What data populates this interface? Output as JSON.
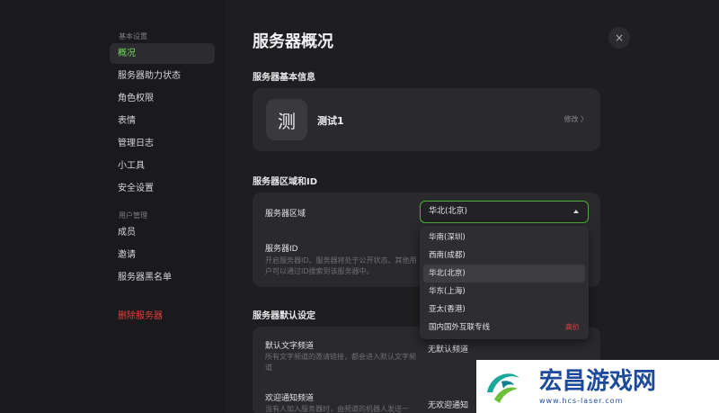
{
  "sidebar": {
    "basic_heading": "基本设置",
    "basic_items": [
      "概况",
      "服务器助力状态",
      "角色权限",
      "表情",
      "管理日志",
      "小工具",
      "安全设置"
    ],
    "user_heading": "用户管理",
    "user_items": [
      "成员",
      "邀请",
      "服务器黑名单"
    ],
    "delete_label": "删除服务器"
  },
  "main": {
    "page_title": "服务器概况",
    "basic_info_title": "服务器基本信息",
    "server_avatar_char": "测",
    "server_name": "测试1",
    "edit_label": "修改 〉",
    "region_title": "服务器区域和ID",
    "region_label": "服务器区域",
    "region_selected": "华北(北京)",
    "id_label": "服务器ID",
    "id_desc": "开启服务器ID、服务器将处于公开状态、其他用户可以通过ID搜索到该服务器中。",
    "defaults_title": "服务器默认设定",
    "default_channel_label": "默认文字频道",
    "default_channel_desc": "所有文字频道的邀请链接，都会进入默认文字频道",
    "default_channel_value": "无默认频道",
    "welcome_label": "欢迎通知频道",
    "welcome_desc": "当有人加入服务器时，由频道的机器人发送一",
    "welcome_value": "无欢迎通知"
  },
  "dropdown": {
    "options": [
      {
        "label": "华南(深圳)",
        "badge": ""
      },
      {
        "label": "西南(成都)",
        "badge": ""
      },
      {
        "label": "华北(北京)",
        "badge": ""
      },
      {
        "label": "华东(上海)",
        "badge": ""
      },
      {
        "label": "亚太(香港)",
        "badge": ""
      },
      {
        "label": "国内国外互联专线",
        "badge": "高价"
      }
    ],
    "highlighted_index": 2
  },
  "close_icon": "×",
  "watermark": {
    "title": "宏昌游戏网",
    "url": "www.hcs-laser.com"
  },
  "colors": {
    "accent_green": "#6fdc5c",
    "danger_red": "#e2413c",
    "select_border": "#4cae3c"
  }
}
